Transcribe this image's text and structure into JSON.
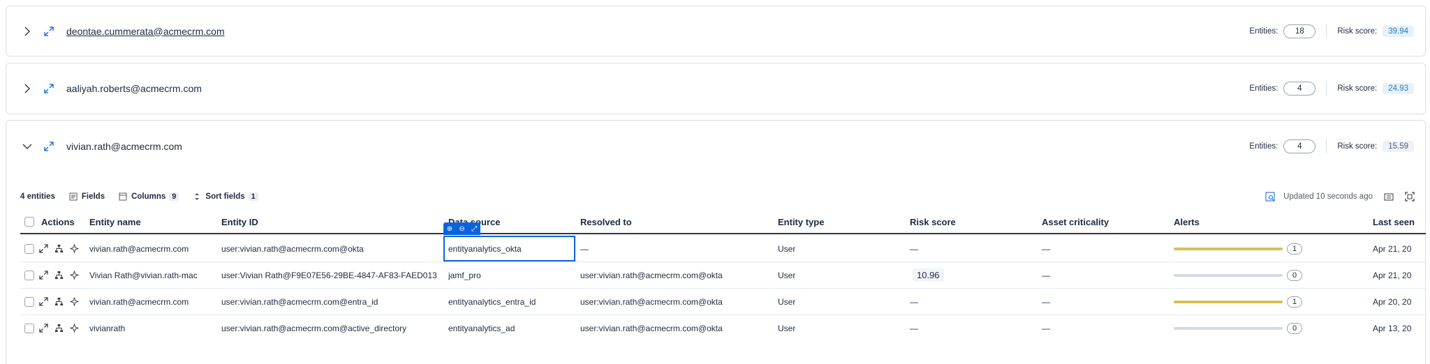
{
  "groups": [
    {
      "email": "deontae.cummerata@acmecrm.com",
      "entities_label": "Entities:",
      "entities": "18",
      "risk_label": "Risk score:",
      "risk": "39.94",
      "risk_color": "#1f7fbf",
      "expanded": false
    },
    {
      "email": "aaliyah.roberts@acmecrm.com",
      "entities_label": "Entities:",
      "entities": "4",
      "risk_label": "Risk score:",
      "risk": "24.93",
      "risk_color": "#1f7fbf",
      "expanded": false
    },
    {
      "email": "vivian.rath@acmecrm.com",
      "entities_label": "Entities:",
      "entities": "4",
      "risk_label": "Risk score:",
      "risk": "15.59",
      "risk_color": "#4a5f7a",
      "expanded": true
    }
  ],
  "toolbar": {
    "entity_count": "4 entities",
    "fields": "Fields",
    "columns": "Columns",
    "columns_count": "9",
    "sort": "Sort fields",
    "sort_count": "1",
    "updated": "Updated 10 seconds ago"
  },
  "table": {
    "headers": {
      "actions": "Actions",
      "entity_name": "Entity name",
      "entity_id": "Entity ID",
      "data_source": "Data source",
      "resolved_to": "Resolved to",
      "entity_type": "Entity type",
      "risk_score": "Risk score",
      "asset_criticality": "Asset criticality",
      "alerts": "Alerts",
      "last_seen": "Last seen"
    },
    "rows": [
      {
        "name": "vivian.rath@acmecrm.com",
        "id": "user:vivian.rath@acmecrm.com@okta",
        "source": "entityanalytics_okta",
        "resolved": "—",
        "type": "User",
        "risk": "—",
        "criticality": "—",
        "alert_fill": 1.0,
        "alert_color": "#d6bf57",
        "alerts": "1",
        "last_seen": "Apr 21, 20"
      },
      {
        "name": "Vivian Rath@vivian.rath-mac",
        "id": "user:Vivian Rath@F9E07E56-29BE-4847-AF83-FAED013",
        "source": "jamf_pro",
        "resolved": "user:vivian.rath@acmecrm.com@okta",
        "type": "User",
        "risk": "10.96",
        "criticality": "—",
        "alert_fill": 1.0,
        "alert_color": "#d3dae6",
        "alerts": "0",
        "last_seen": "Apr 21, 20"
      },
      {
        "name": "vivian.rath@acmecrm.com",
        "id": "user:vivian.rath@acmecrm.com@entra_id",
        "source": "entityanalytics_entra_id",
        "resolved": "user:vivian.rath@acmecrm.com@okta",
        "type": "User",
        "risk": "—",
        "criticality": "—",
        "alert_fill": 1.0,
        "alert_color": "#d6bf57",
        "alerts": "1",
        "last_seen": "Apr 20, 20"
      },
      {
        "name": "vivianrath",
        "id": "user:vivian.rath@acmecrm.com@active_directory",
        "source": "entityanalytics_ad",
        "resolved": "user:vivian.rath@acmecrm.com@okta",
        "type": "User",
        "risk": "—",
        "criticality": "—",
        "alert_fill": 1.0,
        "alert_color": "#d3dae6",
        "alerts": "0",
        "last_seen": "Apr 13, 20"
      }
    ]
  },
  "icons": {
    "collapsed": "chevron-right-icon",
    "expanded": "chevron-down-icon",
    "expand": "expand-icon",
    "tree": "hierarchy-icon",
    "ai": "sparkle-icon"
  },
  "accent": "#0b64dd"
}
